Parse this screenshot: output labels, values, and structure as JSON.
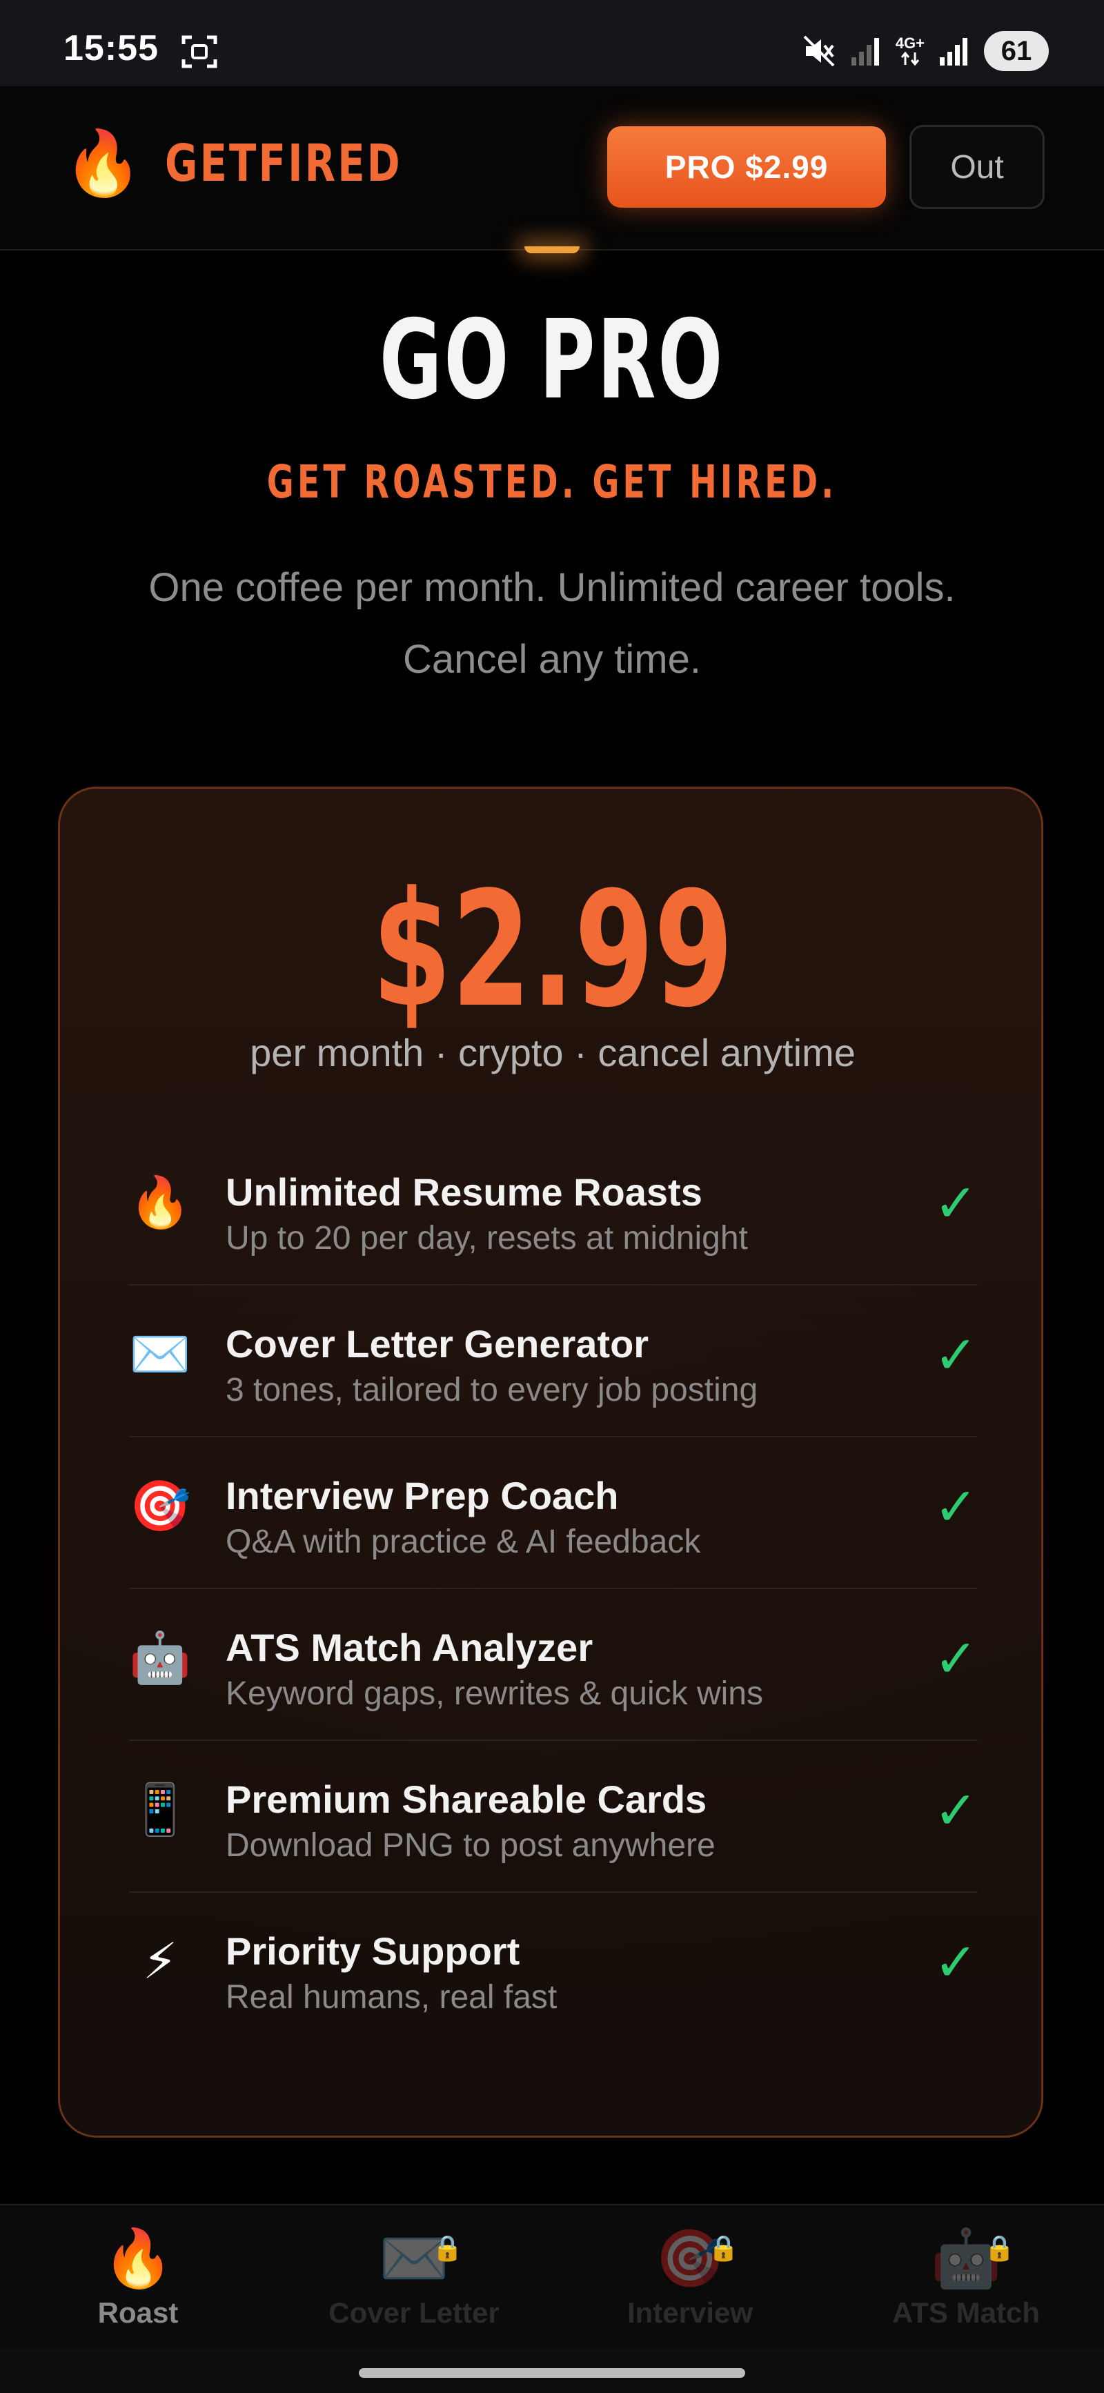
{
  "status_bar": {
    "time": "15:55",
    "network": "4G+",
    "battery": "61"
  },
  "header": {
    "brand_icon": "🔥",
    "brand_name": "GETFIRED",
    "pro_button_label": "PRO $2.99",
    "out_button_label": "Out"
  },
  "hero": {
    "title": "GO PRO",
    "tagline": "GET ROASTED. GET HIRED.",
    "description": "One coffee per month. Unlimited career tools. Cancel any time."
  },
  "pricing": {
    "price": "$2.99",
    "terms": "per month · crypto · cancel anytime",
    "features": [
      {
        "icon": "🔥",
        "icon_name": "fire-icon",
        "title": "Unlimited Resume Roasts",
        "subtitle": "Up to 20 per day, resets at midnight",
        "check": "✓"
      },
      {
        "icon": "✉️",
        "icon_name": "envelope-icon",
        "title": "Cover Letter Generator",
        "subtitle": "3 tones, tailored to every job posting",
        "check": "✓"
      },
      {
        "icon": "🎯",
        "icon_name": "target-icon",
        "title": "Interview Prep Coach",
        "subtitle": "Q&A with practice & AI feedback",
        "check": "✓"
      },
      {
        "icon": "🤖",
        "icon_name": "robot-icon",
        "title": "ATS Match Analyzer",
        "subtitle": "Keyword gaps, rewrites & quick wins",
        "check": "✓"
      },
      {
        "icon": "📱",
        "icon_name": "phone-icon",
        "title": "Premium Shareable Cards",
        "subtitle": "Download PNG to post anywhere",
        "check": "✓"
      },
      {
        "icon": "⚡",
        "icon_name": "lightning-icon",
        "title": "Priority Support",
        "subtitle": "Real humans, real fast",
        "check": "✓"
      }
    ]
  },
  "bottom_nav": {
    "items": [
      {
        "icon": "🔥",
        "label": "Roast",
        "lock": ""
      },
      {
        "icon": "✉️",
        "label": "Cover Letter",
        "lock": "🔒"
      },
      {
        "icon": "🎯",
        "label": "Interview",
        "lock": "🔒"
      },
      {
        "icon": "🤖",
        "label": "ATS Match",
        "lock": "🔒"
      }
    ]
  },
  "colors": {
    "accent": "#f26a34",
    "check": "#2ecc71",
    "background": "#000000"
  }
}
